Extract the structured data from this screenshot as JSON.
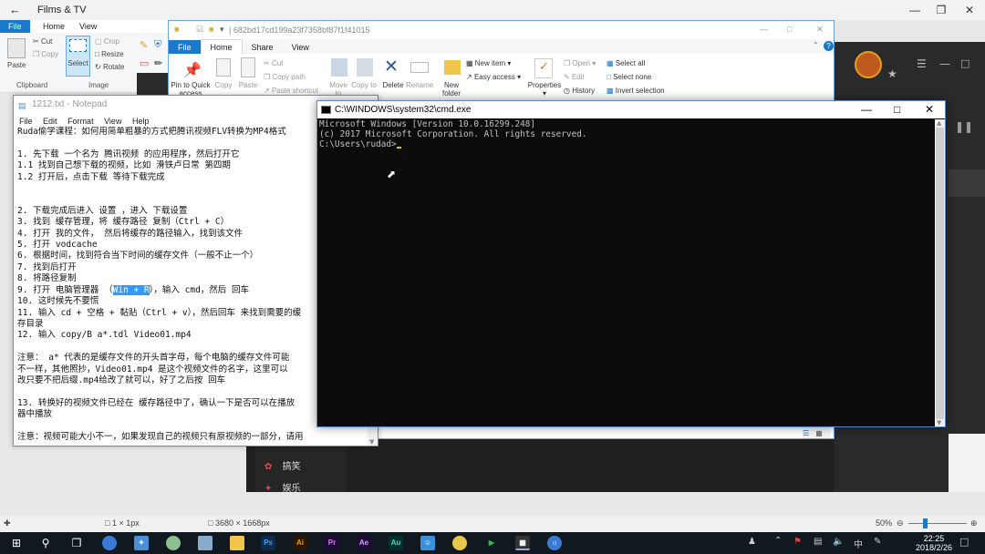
{
  "films": {
    "title": "Films & TV",
    "menu_items": [
      "搞笑",
      "娱乐"
    ]
  },
  "paint": {
    "tabs": [
      "File",
      "Home",
      "View"
    ],
    "clipboard": {
      "paste": "Paste",
      "cut": "Cut",
      "copy": "Copy",
      "group": "Clipboard"
    },
    "image": {
      "select": "Select",
      "crop": "Crop",
      "resize": "Resize",
      "rotate": "Rotate",
      "group": "Image"
    },
    "status_size": "1 × 1px",
    "status_dims": "3680 × 1668px",
    "zoom": "50%"
  },
  "explorer": {
    "path": "682bd17cd199a23f7358bf87f1f41015",
    "tabs": [
      "File",
      "Home",
      "Share",
      "View"
    ],
    "ribbon": {
      "pin": "Pin to Quick access",
      "copy": "Copy",
      "paste": "Paste",
      "cut": "Cut",
      "copy_path": "Copy path",
      "paste_shortcut": "Paste shortcut",
      "move_to": "Move to",
      "copy_to": "Copy to",
      "delete": "Delete",
      "rename": "Rename",
      "new_folder": "New folder",
      "new_item": "New item",
      "easy_access": "Easy access",
      "properties": "Properties",
      "open": "Open",
      "edit": "Edit",
      "history": "History",
      "select_all": "Select all",
      "select_none": "Select none",
      "invert_selection": "Invert selection"
    }
  },
  "notepad": {
    "title": "1212.txt - Notepad",
    "menu": [
      "File",
      "Edit",
      "Format",
      "View",
      "Help"
    ],
    "lines_before_highlight": [
      "Ruda偷学课程：如何用简单粗暴的方式把腾讯视频FLV转换为MP4格式",
      "",
      "1. 先下载 一个名为 腾讯视频 的应用程序，然后打开它",
      "1.1 找到自己想下载的视频，比如 滑铁卢日常 第四期",
      "1.2 打开后，点击下载 等待下载完成",
      "",
      "",
      "2. 下载完成后进入 设置 ，进入 下载设置",
      "3. 找到 缓存管理，将 缓存路径 复制（Ctrl + C）",
      "4. 打开 我的文件， 然后将缓存的路径输入，找到该文件",
      "5. 打开 vodcache",
      "6. 根据时间，找到符合当下时间的缓存文件（一般不止一个）",
      "7. 找到后打开",
      "8. 将路径复制"
    ],
    "line9_prefix": "9. 打开 电脑管理器 （",
    "line9_highlight": "Win + R",
    "line9_suffix": "），输入 cmd，然后 回车",
    "lines_after_highlight": [
      "10. 这时候先不要慌",
      "11. 输入 cd + 空格 + 黏贴（Ctrl + v），然后回车 来找到需要的缓",
      "存目录",
      "12. 输入 copy/B a*.tdl Video01.mp4",
      "",
      "注意： a* 代表的是缓存文件的开头首字母，每个电脑的缓存文件可能",
      "不一样，其他照抄，Video01.mp4 是这个视频文件的名字，这里可以",
      "改只要不把后缀.mp4给改了就可以，好了之后按 回车",
      "",
      "13. 转换好的视频文件已经在 缓存路径中了，确认一下是否可以在播放",
      "器中播放",
      "",
      "注意：视频可能大小不一，如果发现自己的视频只有原视频的一部分，请用"
    ]
  },
  "cmd": {
    "title": "C:\\WINDOWS\\system32\\cmd.exe",
    "lines": [
      "Microsoft Windows [Version 10.0.16299.248]",
      "(c) 2017 Microsoft Corporation. All rights reserved.",
      "",
      "C:\\Users\\rudad>"
    ]
  },
  "taskbar": {
    "apps": [
      "Ps",
      "Ai",
      "Pr",
      "Ae",
      "Au"
    ],
    "ime": "中",
    "time": "22:25",
    "date": "2018/2/26"
  }
}
